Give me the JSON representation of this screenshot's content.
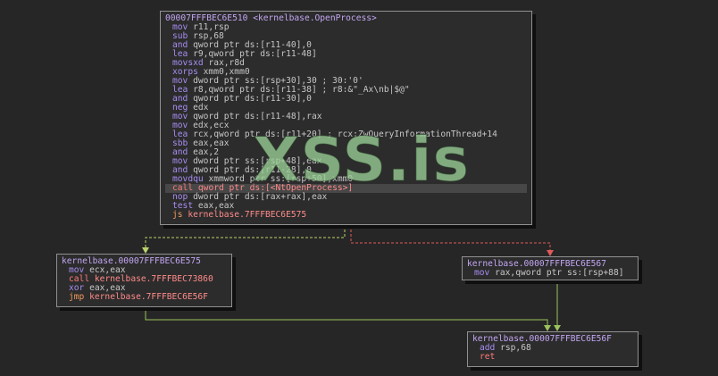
{
  "watermark": "XSS.is",
  "blocks": {
    "main": {
      "label": "00007FFFBEC6E510 <kernelbase.OpenProcess>",
      "lines": [
        {
          "m": "mov ",
          "o": "r11,rsp"
        },
        {
          "m": "sub ",
          "o": "rsp,68"
        },
        {
          "m": "and ",
          "o": "qword ptr ds:[r11-40],0"
        },
        {
          "m": "lea ",
          "o": "r9,qword ptr ds:[r11-48]"
        },
        {
          "m": "movsxd ",
          "o": "rax,r8d"
        },
        {
          "m": "xorps ",
          "o": "xmm0,xmm0"
        },
        {
          "m": "mov ",
          "o": "dword ptr ss:[rsp+30],30 ; 30:'0'"
        },
        {
          "m": "lea ",
          "o": "r8,qword ptr ds:[r11-38] ; r8:&\"_Ax\\nb|$@\""
        },
        {
          "m": "and ",
          "o": "qword ptr ds:[r11-30],0"
        },
        {
          "m": "neg ",
          "o": "edx"
        },
        {
          "m": "mov ",
          "o": "qword ptr ds:[r11-48],rax"
        },
        {
          "m": "mov ",
          "o": "edx,ecx"
        },
        {
          "m": "lea ",
          "o": "rcx,qword ptr ds:[r11+20] ; rcx:ZwQueryInformationThread+14"
        },
        {
          "m": "sbb ",
          "o": "eax,eax"
        },
        {
          "m": "and ",
          "o": "eax,2"
        },
        {
          "m": "mov ",
          "o": "dword ptr ss:[rsp+48],eax"
        },
        {
          "m": "and ",
          "o": "qword ptr ds:[r11-28],0"
        },
        {
          "m": "movdqu ",
          "o": "xmmword ptr ss:[rsp+50],xmm0"
        },
        {
          "m": "call ",
          "o": "qword ptr ds:[<NtOpenProcess>]",
          "kind": "call",
          "hl": true
        },
        {
          "m": "nop ",
          "o": "dword ptr ds:[rax+rax],eax"
        },
        {
          "m": "test ",
          "o": "eax,eax"
        },
        {
          "m": "js ",
          "o": "kernelbase.7FFFBEC6E575",
          "kind": "jmp"
        }
      ]
    },
    "left": {
      "label": "kernelbase.00007FFFBEC6E575",
      "lines": [
        {
          "m": "mov ",
          "o": "ecx,eax"
        },
        {
          "m": "call ",
          "o": "kernelbase.7FFFBEC73860",
          "kind": "call"
        },
        {
          "m": "xor ",
          "o": "eax,eax"
        },
        {
          "m": "jmp ",
          "o": "kernelbase.7FFFBEC6E56F",
          "kind": "jmp"
        }
      ]
    },
    "right": {
      "label": "kernelbase.00007FFFBEC6E567",
      "lines": [
        {
          "m": "mov ",
          "o": "rax,qword ptr ss:[rsp+88]"
        }
      ]
    },
    "bottom": {
      "label": "kernelbase.00007FFFBEC6E56F",
      "lines": [
        {
          "m": "add ",
          "o": "rsp,68"
        },
        {
          "m": "ret",
          "o": "",
          "kind": "ret"
        }
      ]
    }
  }
}
